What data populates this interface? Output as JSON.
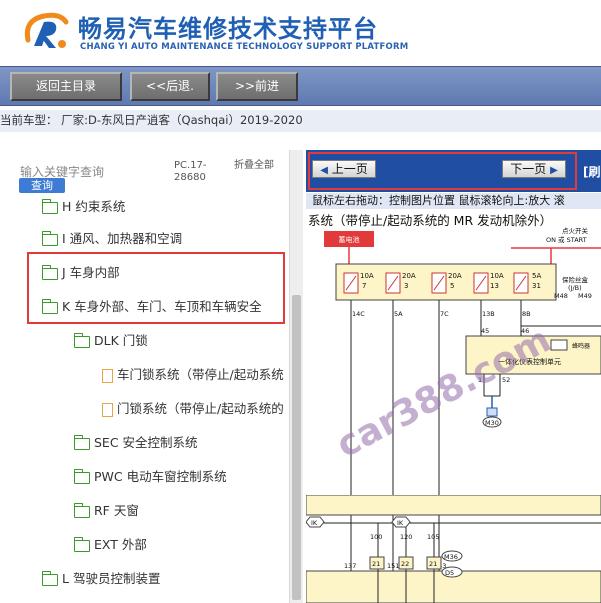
{
  "header": {
    "title_cn": "畅易汽车维修技术支持平台",
    "title_en": "CHANG YI AUTO MAINTENANCE TECHNOLOGY SUPPORT PLATFORM"
  },
  "toolbar": {
    "home_label": "返回主目录",
    "back_label": "<<后退.",
    "forward_label": ">>前进"
  },
  "current_model": "当前车型： 厂家:D-东风日产逍客（Qashqai）2019-2020",
  "search": {
    "placeholder": "输入关键字查询",
    "query_label": "查询",
    "version": "PC.17-\n28680",
    "collapse_label": "折叠全部"
  },
  "tree": [
    {
      "label": "H 约束系统",
      "type": "folder"
    },
    {
      "label": "I 通风、加热器和空调",
      "type": "folder"
    },
    {
      "label": "J 车身内部",
      "type": "folder"
    },
    {
      "label": "K 车身外部、车门、车顶和车辆安全",
      "type": "folder"
    },
    {
      "label": "DLK 门锁",
      "type": "folder"
    },
    {
      "label": "车门锁系统（带停止/起动系统",
      "type": "doc"
    },
    {
      "label": "门锁系统（带停止/起动系统的",
      "type": "doc"
    },
    {
      "label": "SEC 安全控制系统",
      "type": "folder"
    },
    {
      "label": "PWC 电动车窗控制系统",
      "type": "folder"
    },
    {
      "label": "RF 天窗",
      "type": "folder"
    },
    {
      "label": "EXT 外部",
      "type": "folder"
    },
    {
      "label": "L 驾驶员控制装置",
      "type": "folder"
    }
  ],
  "viewer": {
    "prev_page": "上一页",
    "next_page": "下一页",
    "bracket_text": "[刷",
    "hint": "鼠标左右拖动：控制图片位置  鼠标滚轮向上:放大  滚",
    "diagram_title": "系统（带停止/起动系统的 MR 发动机除外）",
    "diagram": {
      "battery": "蓄电池",
      "ignition": "点火开关",
      "ignition_state": "ON 或 START",
      "fusebox": "保险丝盒",
      "fusebox_sub": "(J/B)",
      "fuses": [
        {
          "amp": "10A",
          "num": "7"
        },
        {
          "amp": "20A",
          "num": "3"
        },
        {
          "amp": "20A",
          "num": "5"
        },
        {
          "amp": "10A",
          "num": "13"
        },
        {
          "amp": "5A",
          "num": "31"
        }
      ],
      "wire_labels": [
        "14C",
        "5A",
        "7C",
        "13B",
        "8B"
      ],
      "connectors": [
        "M48",
        "M49",
        "M30",
        "M36",
        "D5"
      ],
      "bcm": "一体化仪表控制单元",
      "buzzer": "蜂鸣器",
      "pins_top": [
        "45",
        "46"
      ],
      "pins_mid": [
        "1",
        "52"
      ],
      "pins_bottom": [
        "137",
        "151",
        "143"
      ],
      "pins_low": [
        "100",
        "120",
        "105"
      ],
      "ik_tag": "IK",
      "boxes_low": [
        "21",
        "22",
        "21"
      ]
    }
  },
  "watermark": "car388.com",
  "colors": {
    "brand_blue": "#1f5fb4",
    "toolbar": "#6b84bb",
    "highlight": "#e23a3a",
    "folder": "#3a9a2a",
    "doc": "#e9a44a",
    "query": "#3d7bd5"
  }
}
